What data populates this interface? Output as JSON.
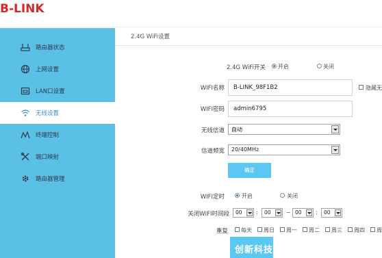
{
  "header": {
    "logo": "B-LINK"
  },
  "sidebar": {
    "items": [
      {
        "label": "路由器状态",
        "icon": "router-icon"
      },
      {
        "label": "上网设置",
        "icon": "globe-icon"
      },
      {
        "label": "LAN口设置",
        "icon": "lan-icon"
      },
      {
        "label": "无线设置",
        "icon": "wifi-icon",
        "active": true
      },
      {
        "label": "终端控制",
        "icon": "signal-icon"
      },
      {
        "label": "端口映射",
        "icon": "tools-icon"
      },
      {
        "label": "路由器管理",
        "icon": "gear-icon"
      }
    ]
  },
  "main": {
    "section_title": "2.4G WiFi设置",
    "wifi_switch": {
      "label": "2.4G WiFi开关",
      "on": "开启",
      "off": "关闭",
      "selected": "on"
    },
    "ssid": {
      "label": "WIFI名称",
      "value": "B-LINK_98F1B2",
      "hide_label": "隐藏无"
    },
    "password": {
      "label": "WIFI密码",
      "value": "admin6795"
    },
    "channel": {
      "label": "无线信道",
      "value": "自动"
    },
    "bandwidth": {
      "label": "信道频宽",
      "value": "20/40MHz"
    },
    "confirm_label": "确定",
    "timer": {
      "label": "WIFI定时",
      "on": "开启",
      "off": "关闭",
      "selected": "on"
    },
    "off_period": {
      "label": "关闭WIFI时间段",
      "start_h": "00",
      "start_m": "00",
      "end_h": "00",
      "end_m": "00",
      "colon": ":",
      "tilde": "~"
    },
    "repeat": {
      "label": "重复",
      "days": [
        "每天",
        "周日",
        "周一",
        "周二",
        "周三",
        "周四",
        "周"
      ]
    },
    "watermark": "创新科技"
  },
  "colors": {
    "sidebar": "#5ac0e6",
    "button": "#5ac8f0",
    "logo": "#d9262d"
  }
}
